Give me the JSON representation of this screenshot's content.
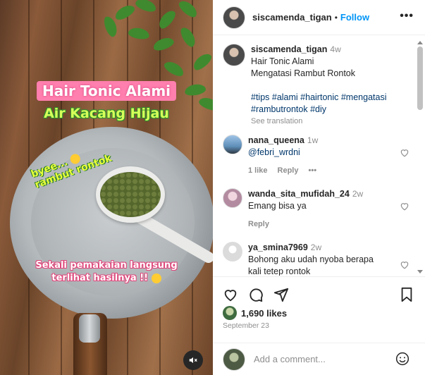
{
  "media": {
    "title": "Hair Tonic Alami",
    "subtitle": "Air Kacang Hijau",
    "bye_line1": "byee...",
    "bye_line2": "rambut rontok",
    "bottom_line1": "Sekali pemakaian langsung",
    "bottom_line2": "terlihat hasilnya !!"
  },
  "header": {
    "username": "siscamenda_tigan",
    "dot": "•",
    "follow": "Follow",
    "more": "•••"
  },
  "caption": {
    "username": "siscamenda_tigan",
    "time": "4w",
    "line1": "Hair Tonic Alami",
    "line2": "Mengatasi Rambut Rontok",
    "hashtags1": "#tips #alami #hairtonic #mengatasi",
    "hashtags2": "#rambutrontok #diy",
    "see_translation": "See translation"
  },
  "comments": [
    {
      "username": "nana_queena",
      "time": "1w",
      "text": "@febri_wrdni",
      "likes": "1 like",
      "reply": "Reply",
      "more": "•••"
    },
    {
      "username": "wanda_sita_mufidah_24",
      "time": "2w",
      "text": "Emang bisa ya",
      "reply": "Reply"
    },
    {
      "username": "ya_smina7969",
      "time": "2w",
      "text": "Bohong aku udah nyoba berapa kali tetep rontok"
    }
  ],
  "stats": {
    "likes": "1,690 likes",
    "date": "September 23"
  },
  "add_comment": {
    "placeholder": "Add a comment..."
  },
  "colors": {
    "accent": "#0095f6",
    "text": "#262626",
    "muted": "#8e8e8e"
  }
}
